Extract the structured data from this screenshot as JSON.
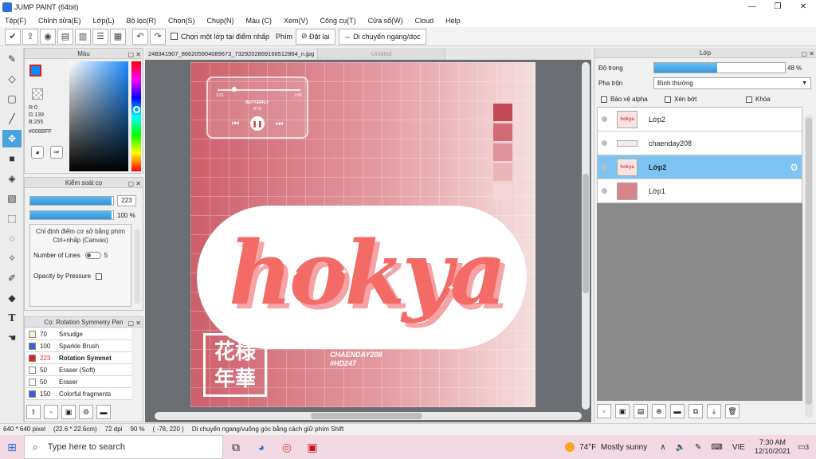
{
  "window": {
    "title": "JUMP PAINT (64bit)",
    "controls": [
      "—",
      "❐",
      "✕"
    ]
  },
  "menu": [
    "Tệp(F)",
    "Chỉnh sửa(E)",
    "Lớp(L)",
    "Bộ lọc(R)",
    "Chọn(S)",
    "Chụp(N)",
    "Màu (C)",
    "Xem(V)",
    "Công cụ(T)",
    "Cửa sổ(W)",
    "Cloud",
    "Help"
  ],
  "toolbar": {
    "select_layer_label": "Chọn một lớp tại điểm nhấp",
    "snap_label": "Phím",
    "reset_label": "Đặt lại",
    "move_label": "Di chuyển ngang/dọc"
  },
  "color_panel": {
    "title": "Màu",
    "r": "R:0",
    "g": "G:139",
    "b": "B:255",
    "hex": "#008BFF",
    "fg_color": "#008BFF"
  },
  "brush_control": {
    "title": "Kiểm soát cọ",
    "size": 223,
    "size_fraction": 0.98,
    "opacity_label": "100 %",
    "opacity_fraction": 0.98,
    "note": "Chỉ định điểm cơ sở bằng phím Ctrl+nhấp (Canvas)",
    "lines_label": "Number of Lines",
    "lines_value": "5",
    "pressure_label": "Opacity by Pressure"
  },
  "brush_list": {
    "title": "Cọ: Rotation Symmetry Pen",
    "items": [
      {
        "size": "70",
        "name": "Smudge",
        "color": "#ffe9d0"
      },
      {
        "size": "100",
        "name": "Sparkle Brush",
        "color": "#3b5bd9"
      },
      {
        "size": "223",
        "name": "Rotation Symmet",
        "color": "#e02020",
        "selected": true
      },
      {
        "size": "50",
        "name": "Eraser (Soft)",
        "color": "#ffffff"
      },
      {
        "size": "50",
        "name": "Eraser",
        "color": "#ffffff"
      },
      {
        "size": "150",
        "name": "Colorful fragments",
        "color": "#3b5bd9"
      }
    ]
  },
  "document": {
    "active_tab": "248341907_866205904089673_7329202869166512864_n.jpg",
    "inactive_tab": "Untitled",
    "player": {
      "start": "1:01",
      "end": "3:56",
      "song": "BUTTERFLY",
      "artist": "BTS"
    },
    "logo": "hokya",
    "stamp_top": "花様",
    "stamp_bottom": "年華",
    "credit_line1": "CHAENDAY208",
    "credit_line2": "#HD247",
    "palette_colors": [
      "#c34b56",
      "#d26b74",
      "#e0939a",
      "#ebb6ba",
      "#f3d6d8"
    ]
  },
  "layer_panel": {
    "title": "Lớp",
    "opacity_label": "Độ trong",
    "opacity_value": "48 %",
    "opacity_fraction": 0.48,
    "blend_label": "Pha trộn",
    "blend_value": "Bình thường",
    "alpha_lock": "Bảo vệ alpha",
    "clip": "Xén bớt",
    "lock": "Khóa",
    "layers": [
      {
        "name": "Lớp2",
        "thumb": "hokya",
        "selected": false
      },
      {
        "name": "chaenday208",
        "thumb": "",
        "selected": false
      },
      {
        "name": "Lớp2",
        "thumb": "hokya",
        "selected": true
      },
      {
        "name": "Lớp1",
        "thumb": "",
        "selected": false
      }
    ]
  },
  "status": {
    "size": "640 * 640 pixel",
    "cm": "(22.6 * 22.6cm)",
    "dpi": "72 dpi",
    "zoom": "90 %",
    "coords": "( -78, 220 )",
    "hint": "Di chuyển ngang/vuông góc bằng cách giữ phím Shift"
  },
  "taskbar": {
    "search_placeholder": "Type here to search",
    "temperature": "74°F",
    "weather": "Mostly sunny",
    "lang": "VIE",
    "time": "7:30 AM",
    "date": "12/10/2021",
    "notifications": "3"
  }
}
